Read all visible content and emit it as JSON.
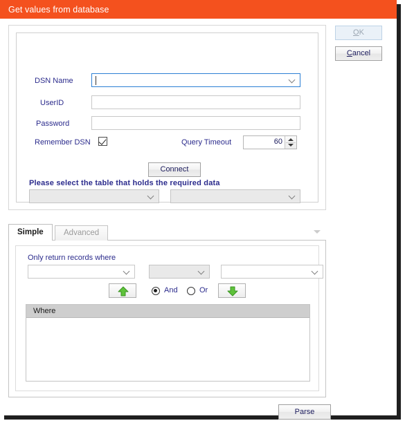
{
  "window": {
    "title": "Get values from database"
  },
  "actions": {
    "ok_label": "OK",
    "ok_accel": "O",
    "ok_rest": "K",
    "ok_enabled": false,
    "cancel_accel": "C",
    "cancel_rest": "ancel",
    "cancel_label": "Cancel"
  },
  "connection": {
    "dsn_label": "DSN Name",
    "dsn_value": "",
    "dsn_focused": true,
    "userid_label": "UserID",
    "userid_value": "",
    "password_label": "Password",
    "password_value": "",
    "remember_label": "Remember DSN",
    "remember_checked": true,
    "timeout_label": "Query Timeout",
    "timeout_value": "60",
    "connect_label": "Connect",
    "table_prompt": "Please select the table that holds the required data",
    "table_value": "",
    "column_value": ""
  },
  "tabs": {
    "items": [
      {
        "label": "Simple",
        "active": true
      },
      {
        "label": "Advanced",
        "active": false
      }
    ],
    "overflow_icon": "chevron-down-icon"
  },
  "filter": {
    "heading": "Only return records where",
    "field_value": "",
    "operator_value": "",
    "value_value": "",
    "move_up_icon": "arrow-up-icon",
    "move_down_icon": "arrow-down-icon",
    "radios": [
      {
        "label": "And",
        "selected": true
      },
      {
        "label": "Or",
        "selected": false
      }
    ],
    "list_header": "Where",
    "list_rows": []
  },
  "footer": {
    "parse_label": "Parse"
  },
  "colors": {
    "title_bar": "#f4511e",
    "label_text": "#2b2b8c",
    "accent_green": "#5ec23a",
    "header_gray": "#cecece",
    "focus_blue": "#2b7fd4"
  }
}
